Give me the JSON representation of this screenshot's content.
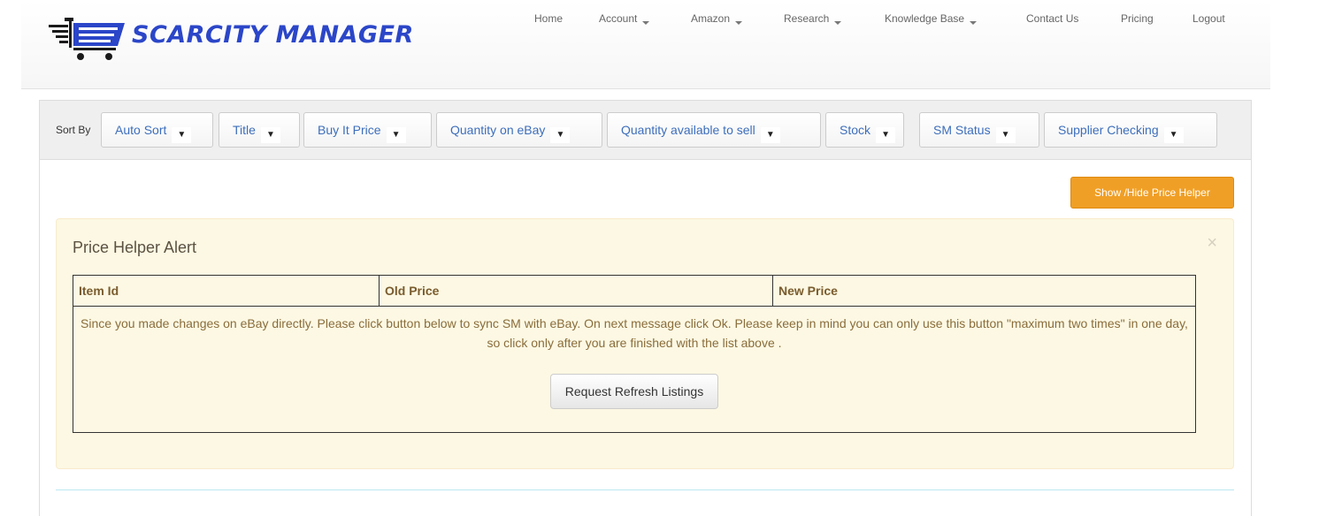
{
  "header": {
    "brand": "SCARCITY MANAGER",
    "nav": [
      {
        "label": "Home",
        "dropdown": false
      },
      {
        "label": "Account",
        "dropdown": true
      },
      {
        "label": "Amazon",
        "dropdown": true
      },
      {
        "label": "Research",
        "dropdown": true
      },
      {
        "label": "Knowledge Base",
        "dropdown": true
      },
      {
        "label": "Contact Us",
        "dropdown": false
      },
      {
        "label": "Pricing",
        "dropdown": false
      },
      {
        "label": "Logout",
        "dropdown": false
      }
    ]
  },
  "sort": {
    "label": "Sort By",
    "buttons": [
      "Auto Sort",
      "Title",
      "Buy It Price",
      "Quantity on eBay",
      "Quantity available to sell",
      "Stock",
      "SM Status",
      "Supplier Checking"
    ]
  },
  "price_helper_button": "Show /Hide Price Helper",
  "alert": {
    "title": "Price Helper Alert",
    "close": "×",
    "columns": [
      "Item Id",
      "Old Price",
      "New Price"
    ],
    "message": "Since you made changes on eBay directly. Please click button below to sync SM with eBay. On next message click Ok. Please keep in mind you can only use this button \"maximum two times\" in one day, so click only after you are finished with the list above .",
    "refresh_button": "Request Refresh Listings"
  },
  "colors": {
    "brand_blue": "#2b46c8",
    "accent_orange": "#f09f26",
    "alert_bg": "#fcf8e3",
    "link_blue": "#3d6ebb"
  }
}
